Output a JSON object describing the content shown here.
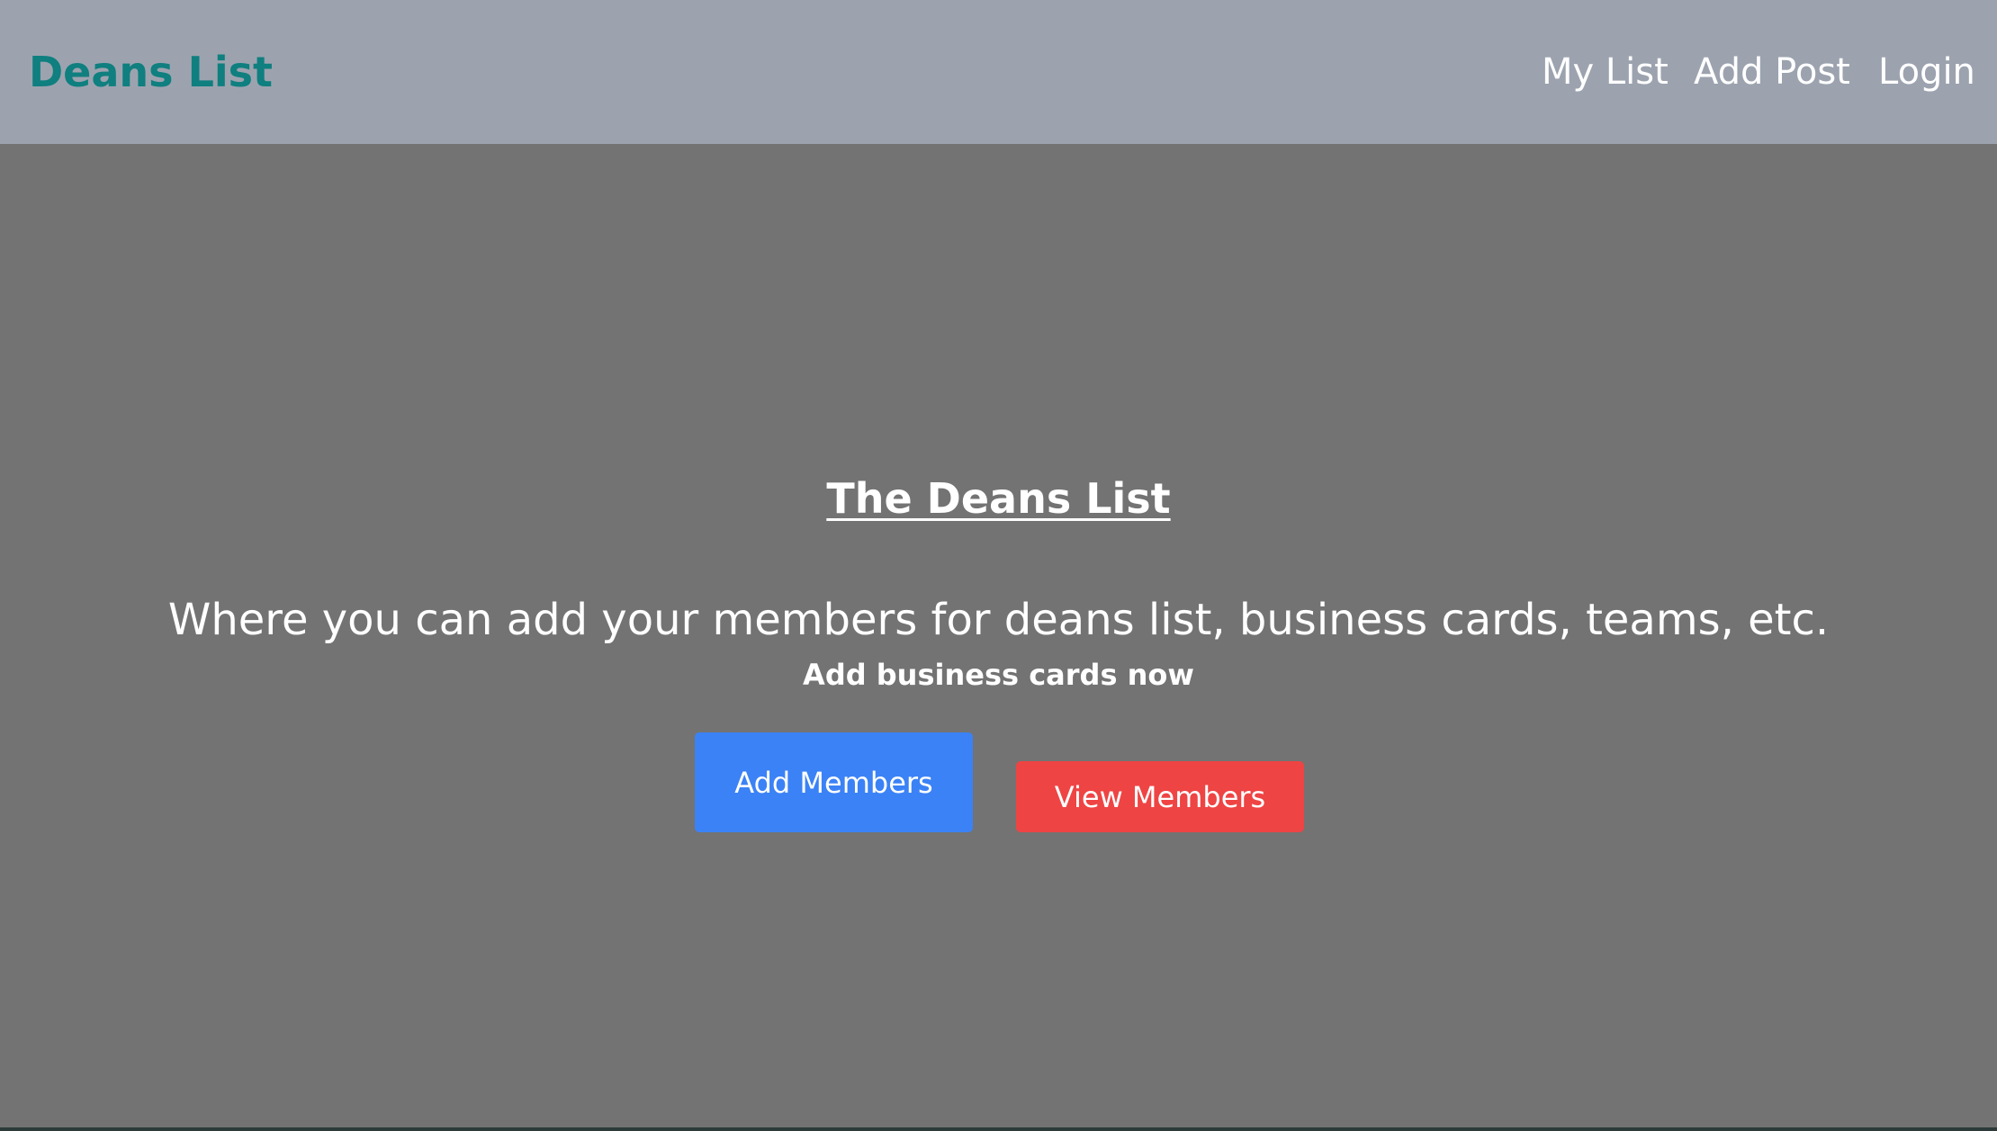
{
  "navbar": {
    "brand": "Deans List",
    "links": {
      "my_list": "My List",
      "add_post": "Add Post",
      "login": "Login"
    }
  },
  "hero": {
    "title": "The Deans List",
    "subtitle": "Where you can add your members for deans list, business cards, teams, etc.",
    "cta_text": "Add business cards now",
    "buttons": {
      "add_members": "Add Members",
      "view_members": "View Members"
    }
  },
  "colors": {
    "navbar_bg": "#9ca3af",
    "page_bg": "#737373",
    "brand": "#0f7f7f",
    "add_button": "#3b82f6",
    "view_button": "#ef4444"
  }
}
